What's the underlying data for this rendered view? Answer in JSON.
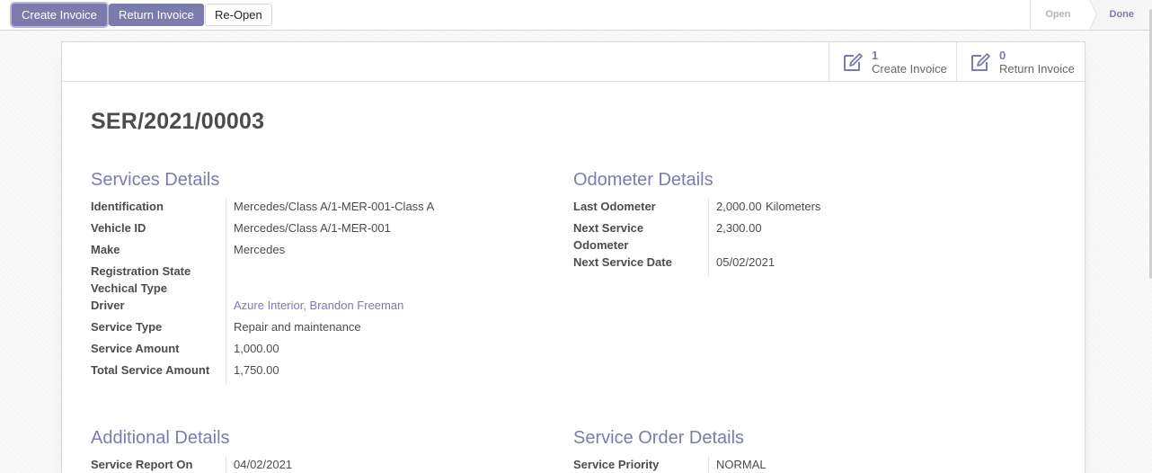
{
  "control_panel": {
    "buttons": {
      "create_invoice": "Create Invoice",
      "return_invoice": "Return Invoice",
      "reopen": "Re-Open"
    },
    "statusbar": {
      "stages": [
        "Open",
        "Done"
      ],
      "current": "Done"
    }
  },
  "smart_buttons": [
    {
      "count": "1",
      "label": "Create Invoice",
      "icon": "pencil-square-icon"
    },
    {
      "count": "0",
      "label": "Return Invoice",
      "icon": "pencil-square-icon"
    }
  ],
  "record": {
    "name": "SER/2021/00003"
  },
  "services_details": {
    "title": "Services Details",
    "fields": {
      "identification": {
        "label": "Identification",
        "value": "Mercedes/Class A/1-MER-001-Class A"
      },
      "vehicle_id": {
        "label": "Vehicle ID",
        "value": "Mercedes/Class A/1-MER-001"
      },
      "make": {
        "label": "Make",
        "value": "Mercedes"
      },
      "registration_state": {
        "label": "Registration State",
        "value": ""
      },
      "vehicle_type": {
        "label": "Vechical Type",
        "value": ""
      },
      "driver": {
        "label": "Driver",
        "value": "Azure Interior, Brandon Freeman"
      },
      "service_type": {
        "label": "Service Type",
        "value": "Repair and maintenance"
      },
      "service_amount": {
        "label": "Service Amount",
        "value": "1,000.00"
      },
      "total_service_amount": {
        "label": "Total Service Amount",
        "value": "1,750.00"
      }
    }
  },
  "odometer_details": {
    "title": "Odometer Details",
    "fields": {
      "last_odometer": {
        "label": "Last Odometer",
        "value": "2,000.00",
        "unit": "Kilometers"
      },
      "next_service_odometer": {
        "label_line1": "Next Service",
        "label_line2": "Odometer",
        "value": "2,300.00"
      },
      "next_service_date": {
        "label": "Next Service Date",
        "value": "05/02/2021"
      }
    }
  },
  "additional_details": {
    "title": "Additional Details",
    "fields": {
      "service_report_on": {
        "label": "Service Report On",
        "value": "04/02/2021"
      }
    }
  },
  "service_order_details": {
    "title": "Service Order Details",
    "fields": {
      "service_priority": {
        "label": "Service Priority",
        "value": "NORMAL"
      }
    }
  },
  "colors": {
    "brand": "#7c7bad",
    "text": "#4c4c4c",
    "border": "#d9d9d9"
  }
}
